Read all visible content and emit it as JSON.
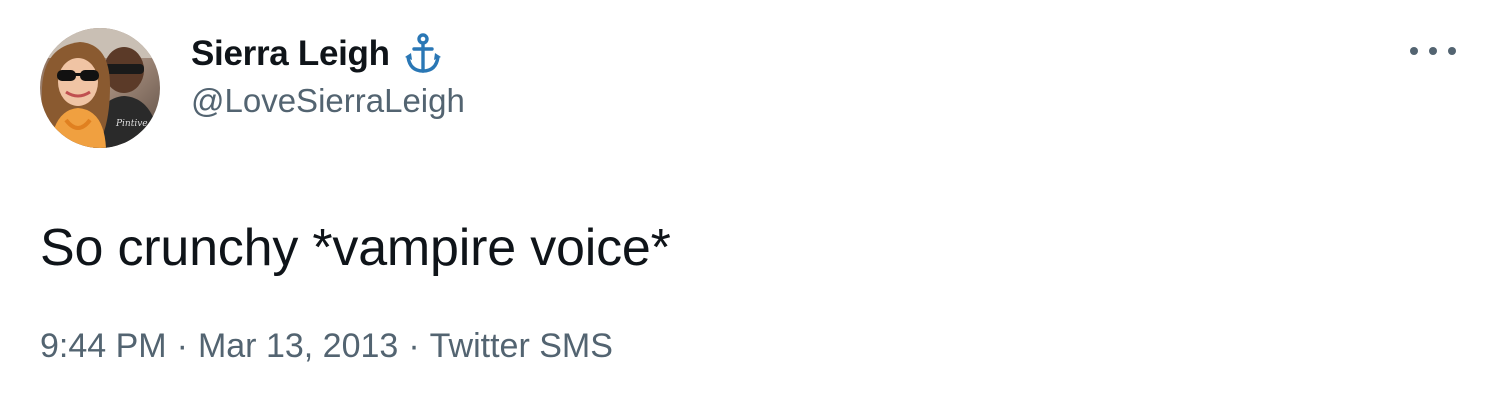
{
  "author": {
    "display_name": "Sierra Leigh",
    "handle": "@LoveSierraLeigh",
    "name_emoji_icon": "anchor-icon",
    "avatar_icon": "profile-photo"
  },
  "tweet": {
    "text": "So crunchy *vampire voice*",
    "time": "9:44 PM",
    "separator": "·",
    "date": "Mar 13, 2013",
    "source": "Twitter SMS"
  },
  "actions": {
    "more_icon": "more-horizontal-icon"
  },
  "colors": {
    "text_primary": "#0f1419",
    "text_secondary": "#536471",
    "anchor_blue": "#2a77b5",
    "background": "#ffffff"
  }
}
